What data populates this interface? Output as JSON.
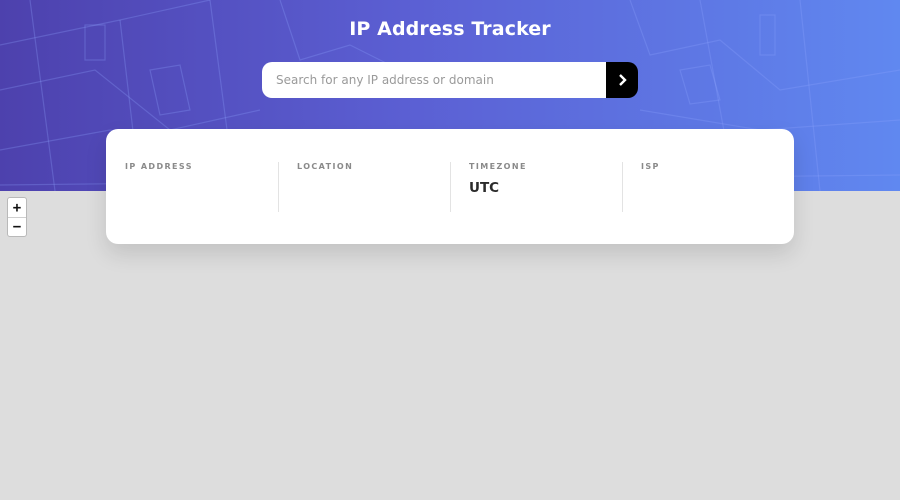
{
  "app": {
    "title": "IP Address Tracker"
  },
  "search": {
    "value": "",
    "placeholder": "Search for any IP address or domain",
    "submit_icon": "chevron-right-icon"
  },
  "info": {
    "items": [
      {
        "label": "IP Address",
        "value": ""
      },
      {
        "label": "Location",
        "value": ""
      },
      {
        "label": "Timezone",
        "value": "UTC"
      },
      {
        "label": "ISP",
        "value": ""
      }
    ]
  },
  "map": {
    "zoom_in_label": "+",
    "zoom_out_label": "−"
  },
  "colors": {
    "header_gradient_start": "#4d41ad",
    "header_gradient_end": "#6088f0",
    "button_background": "#000000",
    "map_background": "#dddddd",
    "card_background": "#ffffff"
  }
}
